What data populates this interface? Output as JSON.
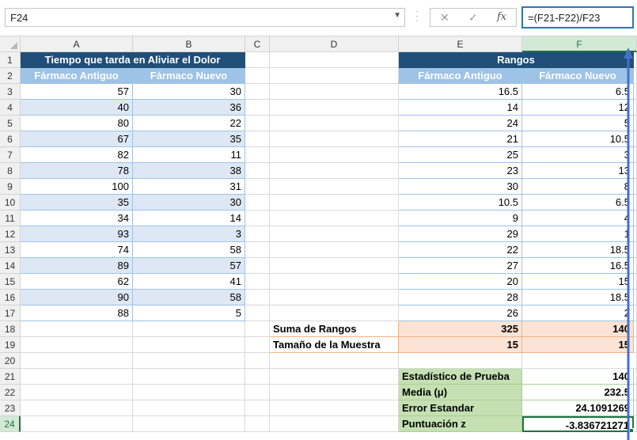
{
  "name_box": "F24",
  "formula": "=(F21-F22)/F23",
  "columns": [
    "A",
    "B",
    "C",
    "D",
    "E",
    "F"
  ],
  "rows": [
    "1",
    "2",
    "3",
    "4",
    "5",
    "6",
    "7",
    "8",
    "9",
    "10",
    "11",
    "12",
    "13",
    "14",
    "15",
    "16",
    "17",
    "18",
    "19",
    "20",
    "21",
    "22",
    "23",
    "24"
  ],
  "left_table": {
    "title": "Tiempo que tarda en Aliviar el Dolor",
    "headers": [
      "Fármaco Antiguo",
      "Fármaco Nuevo"
    ],
    "rows": [
      [
        "57",
        "30"
      ],
      [
        "40",
        "36"
      ],
      [
        "80",
        "22"
      ],
      [
        "67",
        "35"
      ],
      [
        "82",
        "11"
      ],
      [
        "78",
        "38"
      ],
      [
        "100",
        "31"
      ],
      [
        "35",
        "30"
      ],
      [
        "34",
        "14"
      ],
      [
        "93",
        "3"
      ],
      [
        "74",
        "58"
      ],
      [
        "89",
        "57"
      ],
      [
        "62",
        "41"
      ],
      [
        "90",
        "58"
      ],
      [
        "88",
        "5"
      ]
    ]
  },
  "right_table": {
    "title": "Rangos",
    "headers": [
      "Fármaco Antiguo",
      "Fármaco Nuevo"
    ],
    "rows": [
      [
        "16.5",
        "6.5"
      ],
      [
        "14",
        "12"
      ],
      [
        "24",
        "5"
      ],
      [
        "21",
        "10.5"
      ],
      [
        "25",
        "3"
      ],
      [
        "23",
        "13"
      ],
      [
        "30",
        "8"
      ],
      [
        "10.5",
        "6.5"
      ],
      [
        "9",
        "4"
      ],
      [
        "29",
        "1"
      ],
      [
        "22",
        "18.5"
      ],
      [
        "27",
        "16.5"
      ],
      [
        "20",
        "15"
      ],
      [
        "28",
        "18.5"
      ],
      [
        "26",
        "2"
      ]
    ]
  },
  "summary": [
    {
      "label": "Suma de Rangos",
      "e": "325",
      "f": "140"
    },
    {
      "label": "Tamaño de la Muestra",
      "e": "15",
      "f": "15"
    }
  ],
  "stats": [
    {
      "label": "Estadístico de Prueba",
      "value": "140"
    },
    {
      "label": "Media (μ)",
      "value": "232.5"
    },
    {
      "label": "Error Estandar",
      "value": "24.1091269"
    },
    {
      "label": "Puntuación z",
      "value": "-3.836721271"
    }
  ]
}
